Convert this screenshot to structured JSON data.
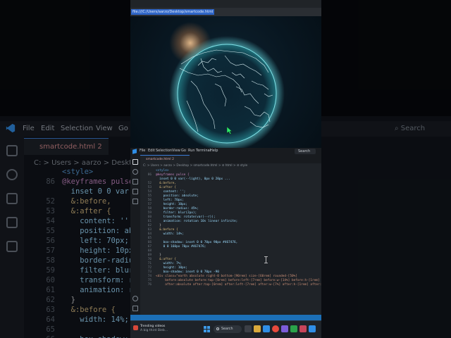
{
  "background_editor": {
    "menu": [
      "File",
      "Edit",
      "Selection",
      "View",
      "Go"
    ],
    "search_label": "Search",
    "tab_label": "smartcode.html 2",
    "breadcrumb": "C: > Users > aarzo > Desktop >",
    "lines": [
      {
        "n": "",
        "t": "<style>",
        "c": "#569cd6"
      },
      {
        "n": "86",
        "t": "@keyframes pulse {",
        "c": "#c586c0"
      },
      {
        "n": "",
        "t": "  inset 0 0 var(--",
        "c": "#9cdcfe"
      },
      {
        "n": "52",
        "t": "  &:before,",
        "c": "#d7ba7d"
      },
      {
        "n": "53",
        "t": "  &:after {",
        "c": "#d7ba7d"
      },
      {
        "n": "54",
        "t": "    content: '';",
        "c": "#9cdcfe"
      },
      {
        "n": "55",
        "t": "    position: abso",
        "c": "#9cdcfe"
      },
      {
        "n": "56",
        "t": "    left: 70px;",
        "c": "#9cdcfe"
      },
      {
        "n": "57",
        "t": "    height: 10px;",
        "c": "#9cdcfe"
      },
      {
        "n": "58",
        "t": "    border-radius",
        "c": "#9cdcfe"
      },
      {
        "n": "59",
        "t": "    filter: blur(",
        "c": "#9cdcfe"
      },
      {
        "n": "60",
        "t": "    transform: ro",
        "c": "#9cdcfe"
      },
      {
        "n": "61",
        "t": "    animation: ro",
        "c": "#9cdcfe"
      },
      {
        "n": "62",
        "t": "  }",
        "c": "#d4d4d4"
      },
      {
        "n": "63",
        "t": "  &:before {",
        "c": "#d7ba7d"
      },
      {
        "n": "64",
        "t": "    width: 14%;",
        "c": "#9cdcfe"
      },
      {
        "n": "65",
        "t": "",
        "c": "#d4d4d4"
      },
      {
        "n": "66",
        "t": "    box-shadow:",
        "c": "#9cdcfe"
      }
    ]
  },
  "browser": {
    "url": "file:///C:/Users/aarzo/Desktop/smartcode.html"
  },
  "vscode": {
    "menu": [
      "File",
      "Edit",
      "Selection",
      "View",
      "Go",
      "Run",
      "Terminal",
      "Help"
    ],
    "search_label": "Search",
    "tab_label": "smartcode.html 2",
    "breadcrumb": "C: > Users > aarzo > Desktop > smartcode.html > ⊘ html > ⊘ style",
    "lines": [
      {
        "n": "",
        "t": "<style>",
        "c": "#569cd6"
      },
      {
        "n": "86",
        "t": "@keyframes pulse {",
        "c": "#c586c0"
      },
      {
        "n": "",
        "t": "  inset 0 0 var(--light), 0px 0 20px ...",
        "c": "#9cdcfe"
      },
      {
        "n": "52",
        "t": "  &:before,",
        "c": "#d7ba7d"
      },
      {
        "n": "53",
        "t": "  &:after {",
        "c": "#d7ba7d"
      },
      {
        "n": "54",
        "t": "    content: '';",
        "c": "#9cdcfe"
      },
      {
        "n": "55",
        "t": "    position: absolute;",
        "c": "#9cdcfe"
      },
      {
        "n": "56",
        "t": "    left: 70px;",
        "c": "#9cdcfe"
      },
      {
        "n": "57",
        "t": "    height: 10px;",
        "c": "#9cdcfe"
      },
      {
        "n": "58",
        "t": "    border-radius: 45%;",
        "c": "#9cdcfe"
      },
      {
        "n": "59",
        "t": "    filter: blur(2px);",
        "c": "#9cdcfe"
      },
      {
        "n": "60",
        "t": "    transform: rotate(var(--r));",
        "c": "#9cdcfe"
      },
      {
        "n": "61",
        "t": "    animation: rotation 10s linear infinite;",
        "c": "#9cdcfe"
      },
      {
        "n": "62",
        "t": "  }",
        "c": "#d4d4d4"
      },
      {
        "n": "63",
        "t": "  &:before {",
        "c": "#d7ba7d"
      },
      {
        "n": "64",
        "t": "    width: 14%;",
        "c": "#9cdcfe"
      },
      {
        "n": "65",
        "t": "",
        "c": "#d4d4d4"
      },
      {
        "n": "66",
        "t": "    box-shadow: inset 0 0 70px 90px #467476,",
        "c": "#9cdcfe"
      },
      {
        "n": "67",
        "t": "    0 0 160px 70px #467476;",
        "c": "#9cdcfe"
      },
      {
        "n": "68",
        "t": "",
        "c": "#d4d4d4"
      },
      {
        "n": "69",
        "t": "  }",
        "c": "#d4d4d4"
      },
      {
        "n": "70",
        "t": "  &:after {",
        "c": "#d7ba7d"
      },
      {
        "n": "71",
        "t": "    width: 7%;",
        "c": "#9cdcfe"
      },
      {
        "n": "72",
        "t": "    height: 10px;",
        "c": "#9cdcfe"
      },
      {
        "n": "73",
        "t": "    box-shadow: inset 0 0 70px -90",
        "c": "#9cdcfe"
      },
      {
        "n": "74",
        "t": "<div class=\"earth absolute right-0 bottom-[90rem] size-[60rem] rounded-[50%]",
        "c": "#ce9178"
      },
      {
        "n": "75",
        "t": "     before:absolute before:top-[0rem] before:left-[7rem] before:w-[14%] before:h-[1rem] before",
        "c": "#ce9178"
      },
      {
        "n": "76",
        "t": "     after:absolute after:top-[0rem] after:left-[7rem] after:w-[7%] after:h-[1rem] after:rounded",
        "c": "#ce9178"
      }
    ]
  },
  "taskbar": {
    "news_title": "Trending videos",
    "news_sub": "A big third Bieb...",
    "search_label": "Search"
  },
  "colors": {
    "accent": "#3a7bd5",
    "globe_glow": "#5fd0d8",
    "globe_lines": "#d8eef2"
  }
}
